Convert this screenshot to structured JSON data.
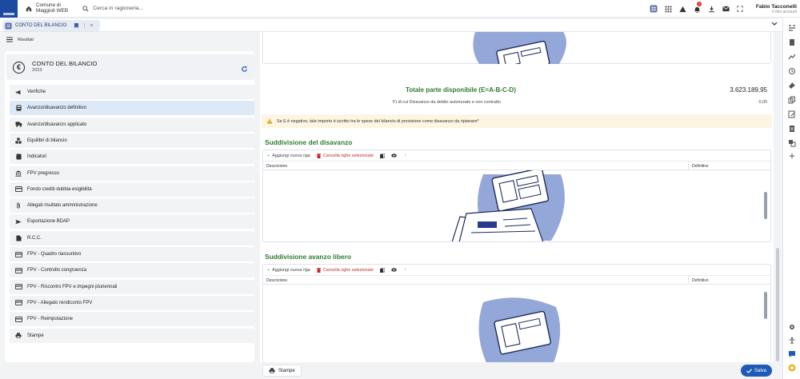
{
  "topbar": {
    "org_line1": "Comune di",
    "org_line2": "Maggioli WEB",
    "search_placeholder": "Cerca in ragioneria...",
    "user_name": "Fabio Tacconelli",
    "user_sub": "Il mio account",
    "notification_count": "1"
  },
  "tabbar": {
    "tab_label": "CONTO DEL BILANCIO"
  },
  "results_label": "Risultati",
  "left": {
    "title": "CONTO DEL BILANCIO",
    "year": "2023",
    "items": [
      {
        "label": "Verifiche",
        "icon": "megaphone-icon"
      },
      {
        "label": "Avanzo/disavanzo definitivo",
        "icon": "calculator-icon"
      },
      {
        "label": "Avanzo/disavanzo applicato",
        "icon": "truck-icon"
      },
      {
        "label": "Equilibri di bilancio",
        "icon": "boxes-icon"
      },
      {
        "label": "Indicatori",
        "icon": "gauge-icon"
      },
      {
        "label": "FPV pregresso",
        "icon": "bank-icon"
      },
      {
        "label": "Fondo crediti dubbia esigibilità",
        "icon": "card-icon"
      },
      {
        "label": "Allegati risultato amministrazione",
        "icon": "paperclip-icon"
      },
      {
        "label": "Esportazione BDAP",
        "icon": "send-icon"
      },
      {
        "label": "R.C.C.",
        "icon": "document-icon"
      },
      {
        "label": "FPV - Quadro riassuntivo",
        "icon": "card-icon"
      },
      {
        "label": "FPV - Controllo congruenza",
        "icon": "card-icon"
      },
      {
        "label": "FPV - Riscontro FPV e impegni pluriennali",
        "icon": "card-icon"
      },
      {
        "label": "FPV - Allegato rendiconto FPV",
        "icon": "card-icon"
      },
      {
        "label": "FPV - Reimputazione",
        "icon": "card-icon"
      },
      {
        "label": "Stampe",
        "icon": "printer-icon"
      }
    ],
    "active_index": 1
  },
  "main": {
    "total_label": "Totale parte disponibile (E=A-B-C-D)",
    "total_value": "3.623.189,95",
    "sub_label": "F) di cui Disavanzo da debito autorizzato e non contratto",
    "sub_value": "0,00",
    "warning": "Se E è negativo, tale importo è iscritto tra le spese del bilancio di previsione come disavanzo da ripianare*",
    "section1_title": "Suddivisione del disavanzo",
    "section2_title": "Suddivisione avanzo libero",
    "add_row": "Aggiungi nuova riga",
    "delete_rows": "Cancella righe selezionate",
    "col_descrizione": "Descrizione",
    "col_definitivo": "Definitivo"
  },
  "bottom": {
    "stampe": "Stampe",
    "salva": "Salva"
  },
  "colors": {
    "accent": "#1e5bb8",
    "green_title": "#2e7d32",
    "delete_red": "#c62828",
    "active_item": "#dde9f7",
    "warning_bg": "#fcf5e1"
  }
}
